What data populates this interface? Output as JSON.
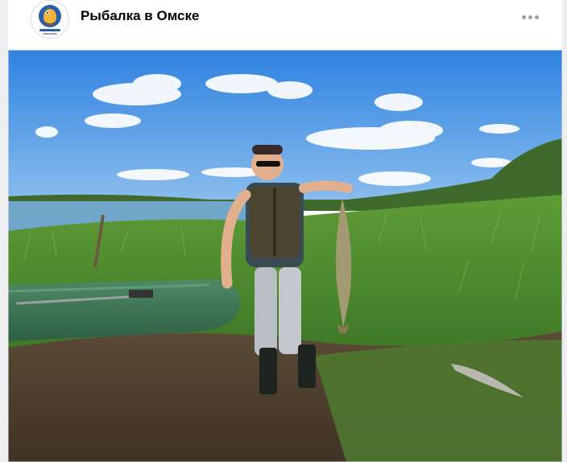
{
  "post": {
    "group_name": "Рыбалка в Омске",
    "avatar_icon": "fishing-club-logo-icon",
    "more_icon": "more-dots-icon"
  },
  "colors": {
    "sky": "#3a8ee6",
    "grass": "#4e8f2e",
    "boat": "#3f7a5a",
    "water": "#6fa6c9"
  }
}
